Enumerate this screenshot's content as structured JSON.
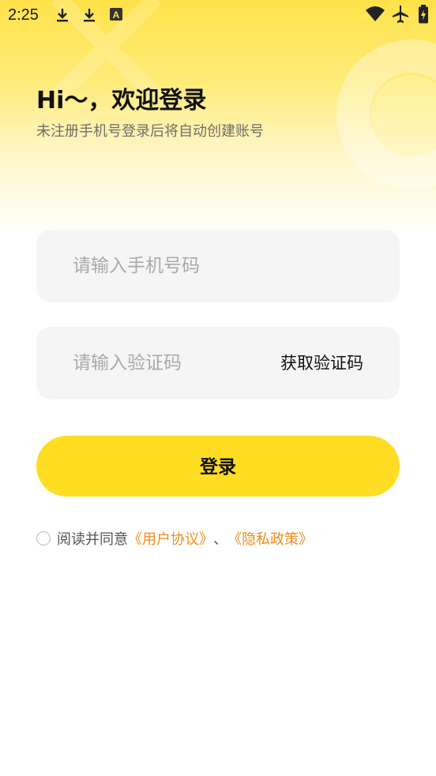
{
  "status_bar": {
    "time": "2:25",
    "left_icons": [
      "download-icon",
      "download-icon",
      "translate-icon"
    ],
    "right_icons": [
      "wifi-icon",
      "airplane-mode-icon",
      "battery-icon"
    ]
  },
  "header": {
    "title": "Hi～，欢迎登录",
    "subtitle": "未注册手机号登录后将自动创建账号"
  },
  "form": {
    "phone_placeholder": "请输入手机号码",
    "code_placeholder": "请输入验证码",
    "get_code_label": "获取验证码",
    "login_label": "登录"
  },
  "agreement": {
    "prefix": "阅读并同意",
    "user_agreement": "《用户协议》",
    "separator": "、",
    "privacy_policy": "《隐私政策》",
    "checked": false
  },
  "colors": {
    "accent": "#FFDD22",
    "link": "#F08A1A",
    "field_bg": "#F5F5F5"
  }
}
